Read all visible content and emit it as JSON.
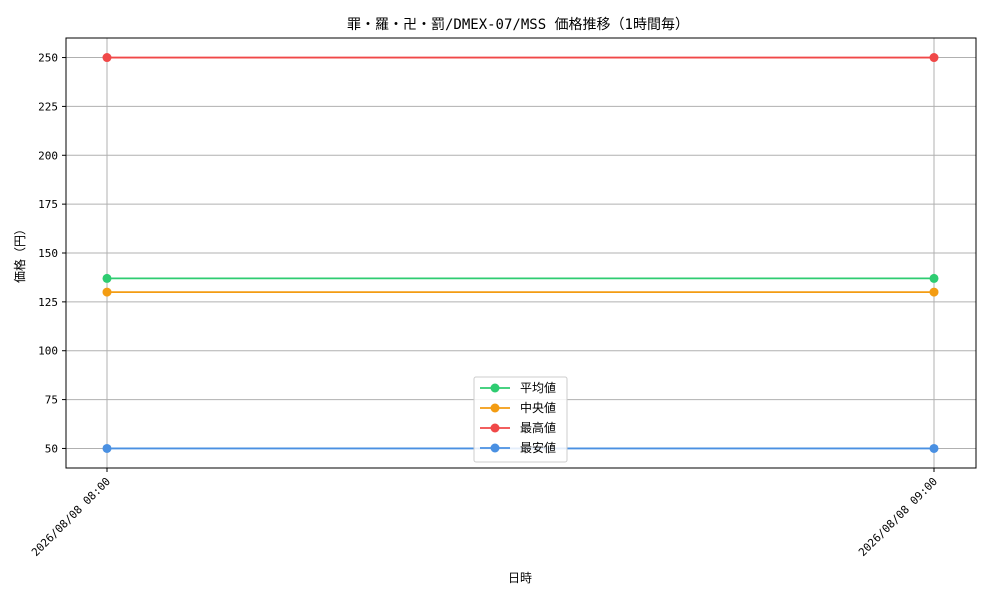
{
  "chart_data": {
    "type": "line",
    "title": "罪・羅・卍・罰/DMEX-07/MSS 価格推移（1時間毎）",
    "xlabel": "日時",
    "ylabel": "価格（円）",
    "x": [
      "2026/08/08 08:00",
      "2026/08/08 09:00"
    ],
    "ylim": [
      40,
      260
    ],
    "yticks": [
      50,
      75,
      100,
      125,
      150,
      175,
      200,
      225,
      250
    ],
    "grid": true,
    "legend_position": "lower-center",
    "series": [
      {
        "name": "平均値",
        "values": [
          137,
          137
        ],
        "color": "#2ecc71"
      },
      {
        "name": "中央値",
        "values": [
          130,
          130
        ],
        "color": "#f39c12"
      },
      {
        "name": "最高値",
        "values": [
          250,
          250
        ],
        "color": "#f04848"
      },
      {
        "name": "最安値",
        "values": [
          50,
          50
        ],
        "color": "#4a90e2"
      }
    ]
  }
}
